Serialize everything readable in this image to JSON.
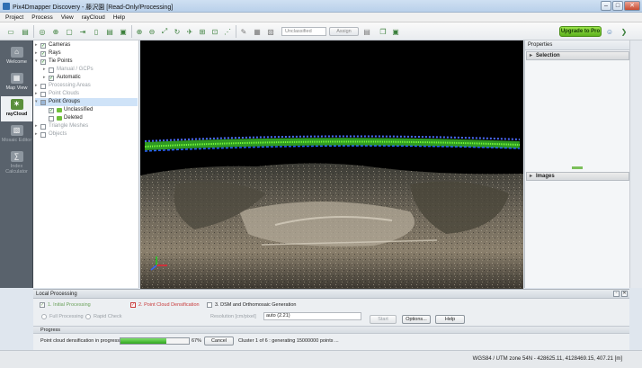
{
  "window": {
    "title": "Pix4Dmapper Discovery - 藤沢園 [Read-Only/Processing]",
    "minimize": "–",
    "maximize": "□",
    "close": "✕"
  },
  "menu": [
    "Project",
    "Process",
    "View",
    "rayCloud",
    "Help"
  ],
  "toolbar": {
    "class_select": "Unclassified",
    "assign_label": "Assign",
    "upgrade_label": "Upgrade to Pro",
    "icons": [
      "new-project-icon",
      "open-project-icon",
      "save-icon",
      "cameras-icon",
      "points-icon",
      "zoom-in-icon",
      "zoom-out-icon",
      "zoom-extent-icon",
      "rotate-icon",
      "select-icon",
      "measure-icon",
      "brush-icon",
      "color-swatch-icon",
      "layers-icon",
      "settings-icon",
      "user-icon",
      "forward-icon"
    ]
  },
  "sidebar": [
    {
      "label": "Welcome",
      "icon": "home-icon",
      "active": false,
      "enabled": true
    },
    {
      "label": "Map View",
      "icon": "map-icon",
      "active": false,
      "enabled": true
    },
    {
      "label": "rayCloud",
      "icon": "raycloud-icon",
      "active": true,
      "enabled": true
    },
    {
      "label": "Mosaic Editor",
      "icon": "mosaic-icon",
      "active": false,
      "enabled": false
    },
    {
      "label": "Index Calculator",
      "icon": "index-icon",
      "active": false,
      "enabled": false
    }
  ],
  "layers": [
    {
      "label": "Cameras",
      "level": 0,
      "checked": "on",
      "dim": false
    },
    {
      "label": "Rays",
      "level": 0,
      "checked": "on",
      "dim": false
    },
    {
      "label": "Tie Points",
      "level": 0,
      "checked": "on",
      "dim": false
    },
    {
      "label": "Manual / GCPs",
      "level": 1,
      "checked": "off",
      "dim": true
    },
    {
      "label": "Automatic",
      "level": 1,
      "checked": "on",
      "dim": false
    },
    {
      "label": "Processing Areas",
      "level": 0,
      "checked": "off",
      "dim": true
    },
    {
      "label": "Point Clouds",
      "level": 0,
      "checked": "off",
      "dim": true
    },
    {
      "label": "Point Groups",
      "level": 0,
      "checked": "part",
      "dim": false,
      "selected": true
    },
    {
      "label": "Unclassified",
      "level": 1,
      "checked": "on",
      "dim": false,
      "swatch": "#6fbf3a"
    },
    {
      "label": "Deleted",
      "level": 1,
      "checked": "off",
      "dim": false,
      "swatch": "#6fbf3a"
    },
    {
      "label": "Triangle Meshes",
      "level": 0,
      "checked": "off",
      "dim": true
    },
    {
      "label": "Objects",
      "level": 0,
      "checked": "off",
      "dim": true
    }
  ],
  "properties": {
    "title": "Properties",
    "selection": "Selection",
    "images": "Images"
  },
  "local_processing": {
    "title": "Local Processing",
    "step1": "1. Initial Processing",
    "step2": "2. Point Cloud Densification",
    "step3": "3. DSM and Orthomosaic Generation",
    "full_processing": "Full Processing",
    "rapid_check": "Rapid Check",
    "resolution_label": "Resolution [cm/pixel]",
    "resolution_value": "auto (2.21)",
    "start": "Start",
    "options": "Options...",
    "help": "Help",
    "progress_title": "Progress",
    "progress_label": "Point cloud densification in progress",
    "progress_value": 0.67,
    "progress_pct": "67%",
    "cancel": "Cancel",
    "progress_detail": "Cluster 1 of 6 : generating 15000000 points ..."
  },
  "status": {
    "coordinates": "WGS84 / UTM zone 54N - 428625.11, 4128469.15, 407.21 [m]"
  }
}
